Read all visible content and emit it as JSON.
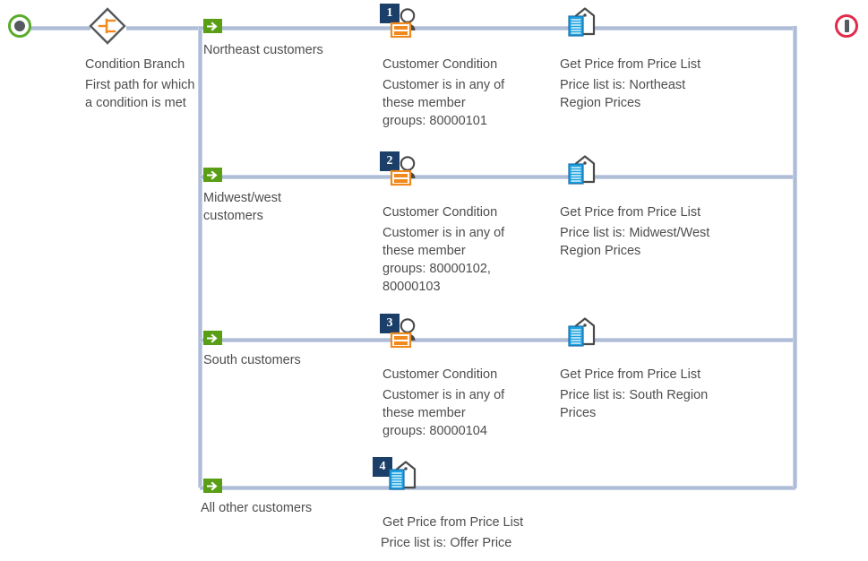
{
  "diagram": {
    "type": "workflow-flowchart",
    "start_node": {
      "name": "start-node",
      "shape": "circle-filled-dot",
      "color": "#5aab2b"
    },
    "end_node": {
      "name": "end-node",
      "shape": "circle-bar",
      "color": "#e02b4a"
    },
    "branch_node": {
      "title": "Condition Branch",
      "description": "First path for which\na condition is met",
      "icon": "condition-branch-icon",
      "accent_color": "#f08a1e"
    },
    "branches": [
      {
        "number": "1",
        "branch_label": "Northeast customers",
        "steps": [
          {
            "icon": "customer-condition-icon",
            "title": "Customer Condition",
            "description": "Customer is in any of\nthese member\ngroups: 80000101"
          },
          {
            "icon": "price-list-icon",
            "title": "Get Price from Price List",
            "description": "Price list is: Northeast\nRegion Prices"
          }
        ]
      },
      {
        "number": "2",
        "branch_label": "Midwest/west\ncustomers",
        "steps": [
          {
            "icon": "customer-condition-icon",
            "title": "Customer Condition",
            "description": "Customer is in any of\nthese member\ngroups: 80000102,\n80000103"
          },
          {
            "icon": "price-list-icon",
            "title": "Get Price from Price List",
            "description": "Price list is: Midwest/West\nRegion Prices"
          }
        ]
      },
      {
        "number": "3",
        "branch_label": "South customers",
        "steps": [
          {
            "icon": "customer-condition-icon",
            "title": "Customer Condition",
            "description": "Customer is in any of\nthese member\ngroups: 80000104"
          },
          {
            "icon": "price-list-icon",
            "title": "Get Price from Price List",
            "description": "Price list is: South Region\nPrices"
          }
        ]
      },
      {
        "number": "4",
        "branch_label": "All other customers",
        "steps": [
          {
            "icon": "price-list-icon",
            "title": "Get Price from Price List",
            "description": "Price list is: Offer Price"
          }
        ]
      }
    ],
    "colors": {
      "connector": "#aebcd6",
      "branch_marker": "#5a9e16",
      "badge": "#1b3f68",
      "text": "#4d4d4d",
      "orange": "#f08a1e",
      "doc_blue": "#1ba1e2",
      "icon_gray": "#4a4a4a"
    }
  }
}
